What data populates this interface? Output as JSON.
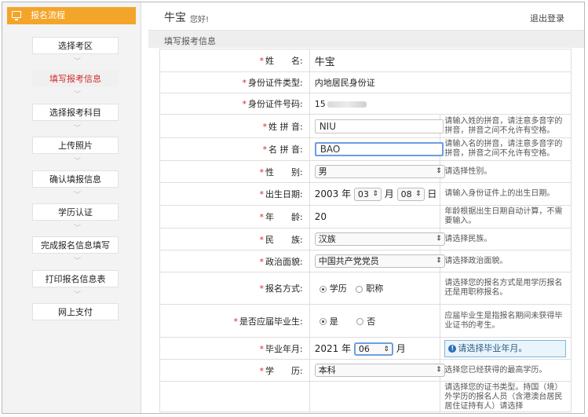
{
  "sidebar": {
    "header": "报名流程",
    "steps": [
      "选择考区",
      "填写报考信息",
      "选择报考科目",
      "上传照片",
      "确认填报信息",
      "学历认证",
      "完成报名信息填写",
      "打印报名信息表",
      "网上支付"
    ],
    "active_index": 1,
    "chevron": "﹀"
  },
  "header": {
    "user": "牛宝",
    "greeting": "您好!",
    "logout": "退出登录"
  },
  "section_title": "填写报考信息",
  "form": {
    "name": {
      "label": "姓　　名:",
      "value": "牛宝"
    },
    "id_type": {
      "label": "身份证件类型:",
      "value": "内地居民身份证"
    },
    "id_number": {
      "label": "身份证件号码:",
      "value": "15"
    },
    "surname_pinyin": {
      "label": "姓 拼 音:",
      "value": "NIU",
      "hint": "请输入姓的拼音，请注意多音字的拼音，拼音之间不允许有空格。"
    },
    "given_pinyin": {
      "label": "名 拼 音:",
      "value": "BAO",
      "hint": "请输入名的拼音，请注意多音字的拼音，拼音之间不允许有空格。"
    },
    "gender": {
      "label": "性　　别:",
      "value": "男",
      "hint": "请选择性别。"
    },
    "birth": {
      "label": "出生日期:",
      "year": "2003",
      "year_unit": "年",
      "month": "03",
      "month_unit": "月",
      "day": "08",
      "day_unit": "日",
      "hint": "请输入身份证件上的出生日期。"
    },
    "age": {
      "label": "年　　龄:",
      "value": "20",
      "hint": "年龄根据出生日期自动计算，不需要输入。"
    },
    "ethnicity": {
      "label": "民　　族:",
      "value": "汉族",
      "hint": "请选择民族。"
    },
    "political": {
      "label": "政治面貌:",
      "value": "中国共产党党员",
      "hint": "请选择政治面貌。"
    },
    "method": {
      "label": "报名方式:",
      "option1": "学历",
      "option2": "职称",
      "hint": "请选择您的报名方式是用学历报名还是用职称报名。"
    },
    "fresh_grad": {
      "label": "是否应届毕业生:",
      "option1": "是",
      "option2": "否",
      "hint": "应届毕业生是指报名期间未获得毕业证书的考生。"
    },
    "grad_date": {
      "label": "毕业年月:",
      "year": "2021",
      "year_unit": "年",
      "month": "06",
      "month_unit": "月",
      "alert": "请选择毕业年月。"
    },
    "education": {
      "label": "学　　历:",
      "value": "本科",
      "hint": "选择您已经获得的最高学历。"
    },
    "certificate": {
      "hint": "请选择您的证书类型。持国（境）外学历的报名人员（含港澳台居民居住证持有人）请选择"
    }
  },
  "icons": {
    "required": "*",
    "select_arrow": "⇕",
    "info": "!"
  }
}
